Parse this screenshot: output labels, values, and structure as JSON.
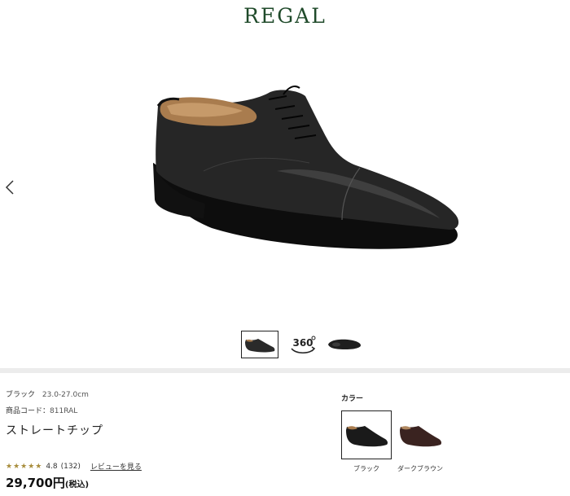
{
  "header": {
    "logo": "REGAL"
  },
  "gallery": {
    "prev_icon": "chevron-left-icon",
    "main_image": "black-oxford-straight-tip-shoe",
    "thumbnails": [
      {
        "icon": "shoe-side-thumbnail",
        "active": true
      },
      {
        "label": "360",
        "icon": "rotate-360-icon",
        "active": false
      },
      {
        "icon": "shoe-top-thumbnail",
        "active": false
      }
    ]
  },
  "product": {
    "color_label": "ブラック",
    "size_range": "23.0-27.0cm",
    "code_label": "商品コード：",
    "code_value": "811RAL",
    "name": "ストレートチップ",
    "rating_stars": "★★★★★",
    "rating_value": "4.8",
    "review_count": "(132)",
    "review_link": "レビューを見る",
    "price": "29,700円",
    "tax_note": "(税込)"
  },
  "colors": {
    "title": "カラー",
    "options": [
      {
        "label": "ブラック",
        "selected": true,
        "swatch": "#1a1a1a"
      },
      {
        "label": "ダークブラウン",
        "selected": false,
        "swatch": "#3a2320"
      }
    ]
  },
  "theme": {
    "brand": "#1f4a2a",
    "star": "#a88d3c",
    "divider": "#ececec"
  }
}
